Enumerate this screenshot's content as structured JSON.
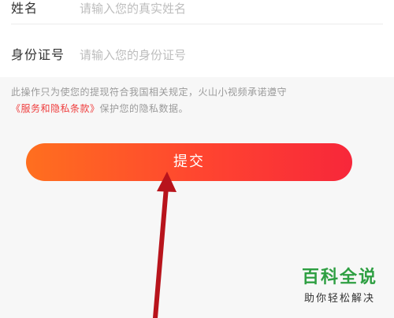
{
  "form": {
    "name_label": "姓名",
    "name_placeholder": "请输入您的真实姓名",
    "id_label": "身份证号",
    "id_placeholder": "请输入您的身份证号"
  },
  "notice": {
    "text_before": "此操作只为使您的提现符合我国相关规定，火山小视频承诺遵守",
    "link_text": "《服务和隐私条款》",
    "text_after": "保护您的隐私数据。"
  },
  "submit": {
    "label": "提交"
  },
  "annotation": {
    "arrow_icon": "red-arrow-icon",
    "color": "#b8141c"
  },
  "watermark": {
    "title": "百科全说",
    "subtitle": "助你轻松解决"
  },
  "colors": {
    "accent_start": "#ff6f1f",
    "accent_end": "#f7273a",
    "link": "#ef3d3d",
    "watermark_green": "#2e9f42"
  }
}
